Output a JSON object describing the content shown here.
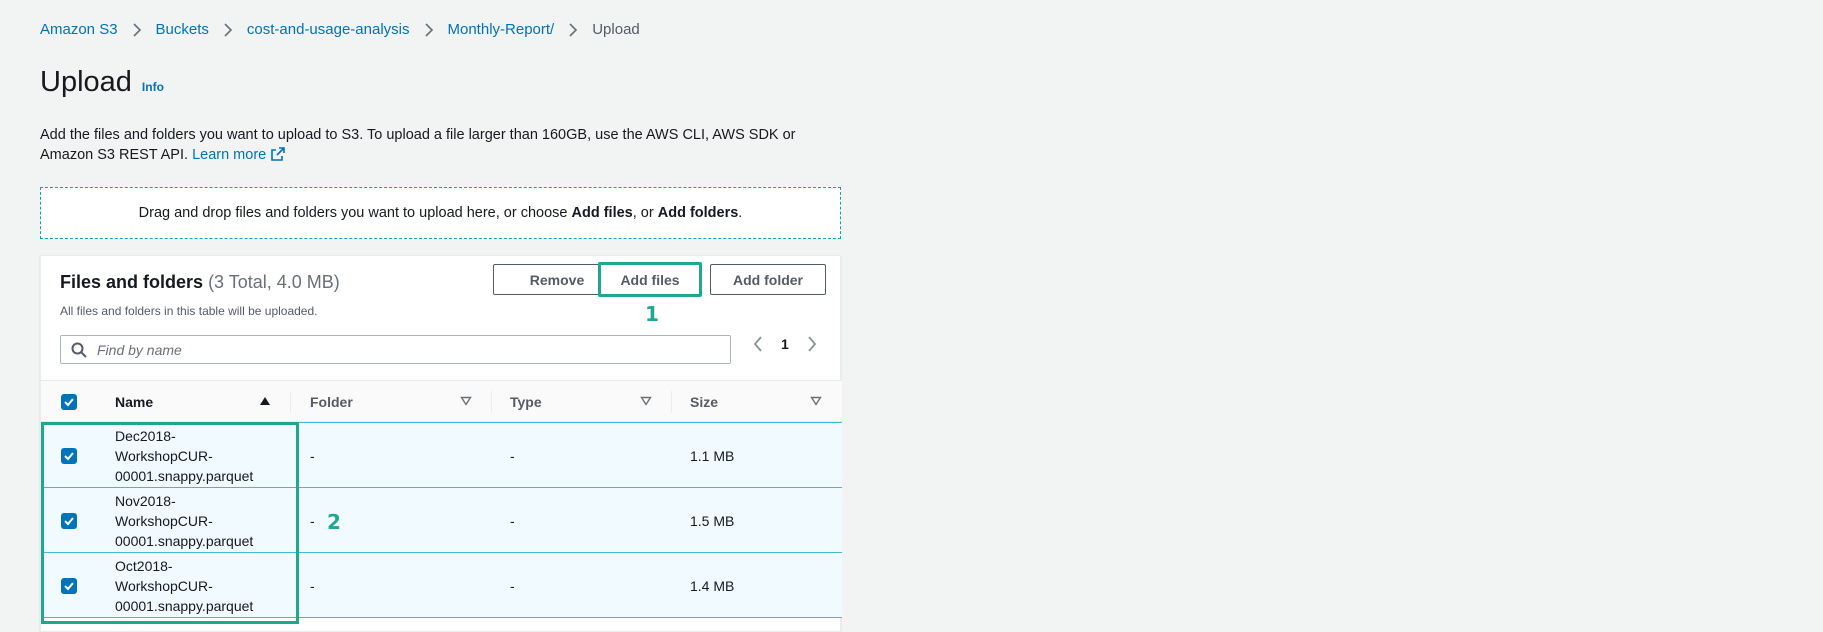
{
  "breadcrumb": {
    "items": [
      "Amazon S3",
      "Buckets",
      "cost-and-usage-analysis",
      "Monthly-Report/"
    ],
    "current": "Upload"
  },
  "header": {
    "title": "Upload",
    "info": "Info"
  },
  "description": {
    "text": "Add the files and folders you want to upload to S3. To upload a file larger than 160GB, use the AWS CLI, AWS SDK or Amazon S3 REST API.",
    "learn_more": "Learn more"
  },
  "dropzone": {
    "prefix": "Drag and drop files and folders you want to upload here, or choose ",
    "add_files": "Add files",
    "mid": ", or ",
    "add_folders": "Add folders",
    "suffix": "."
  },
  "panel": {
    "title": "Files and folders",
    "count": "(3 Total, 4.0 MB)",
    "subtitle": "All files and folders in this table will be uploaded.",
    "buttons": {
      "remove": "Remove",
      "add_files": "Add files",
      "add_folder": "Add folder"
    },
    "search_placeholder": "Find by name",
    "page": "1"
  },
  "callouts": {
    "one": "1",
    "two": "2"
  },
  "table": {
    "columns": {
      "name": "Name",
      "folder": "Folder",
      "type": "Type",
      "size": "Size"
    },
    "rows": [
      {
        "name": "Dec2018-\nWorkshopCUR-\n00001.snappy.parquet",
        "folder": "-",
        "type": "-",
        "size": "1.1 MB",
        "checked": true
      },
      {
        "name": "Nov2018-\nWorkshopCUR-\n00001.snappy.parquet",
        "folder": "-",
        "type": "-",
        "size": "1.5 MB",
        "checked": true
      },
      {
        "name": "Oct2018-\nWorkshopCUR-\n00001.snappy.parquet",
        "folder": "-",
        "type": "-",
        "size": "1.4 MB",
        "checked": true
      }
    ]
  },
  "colors": {
    "link": "#0073bb",
    "highlight": "#1ea88f",
    "selected_row": "#f1faff",
    "selected_border": "#44b9d6"
  },
  "icons": [
    "chevron-right-icon",
    "external-link-icon",
    "search-icon",
    "chevron-left-icon",
    "sort-ascending-icon",
    "sort-icon",
    "checkbox-checked-icon"
  ]
}
